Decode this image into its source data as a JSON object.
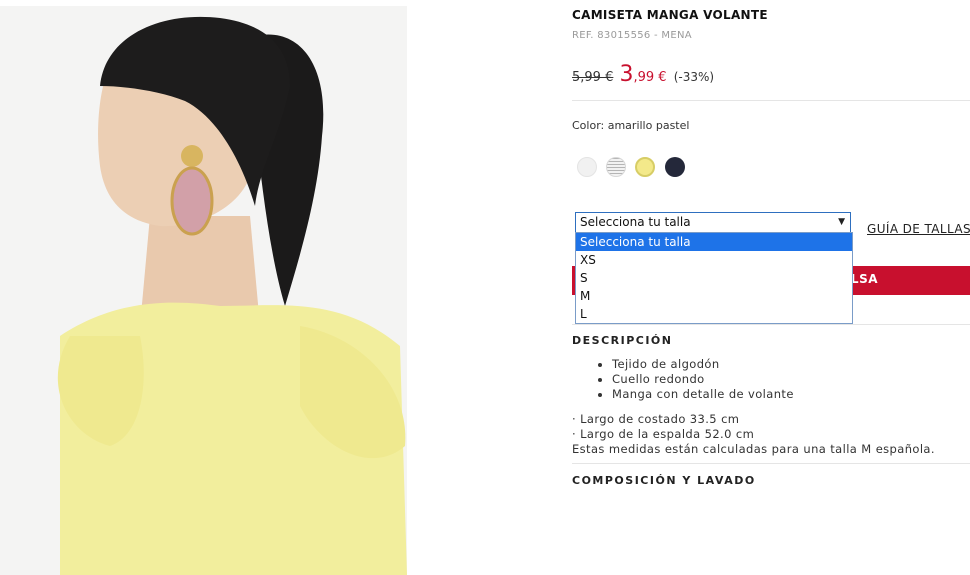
{
  "product": {
    "title": "CAMISETA MANGA VOLANTE",
    "ref": "REF. 83015556 - MENA",
    "price": {
      "old": "5,99 €",
      "new_int": "3",
      "new_dec": ",99 €",
      "discount": "(-33%)"
    },
    "color_label": "Color: amarillo pastel",
    "swatches": [
      {
        "name": "blanco",
        "color": "#f1f1f1"
      },
      {
        "name": "rayas",
        "color": "#b5b5b5"
      },
      {
        "name": "amarillo pastel",
        "color": "#f3e98a",
        "selected": true
      },
      {
        "name": "azul marino",
        "color": "#24283a"
      }
    ],
    "size_select": {
      "value": "Selecciona tu talla",
      "options": [
        "Selecciona tu talla",
        "XS",
        "S",
        "M",
        "L"
      ]
    },
    "size_guide": "GUÍA DE TALLAS",
    "add_to_bag_visible": "LSA",
    "description": {
      "heading": "DESCRIPCIÓN",
      "bullets": [
        "Tejido de algodón",
        "Cuello redondo",
        "Manga con detalle de volante"
      ],
      "details": [
        "· Largo de costado 33.5 cm",
        "· Largo de la espalda 52.0 cm",
        "Estas medidas están calculadas para una talla M española."
      ]
    },
    "composition_heading": "COMPOSICIÓN Y LAVADO"
  },
  "colors": {
    "accent_red": "#c8102e",
    "select_blue": "#1e73e8"
  }
}
